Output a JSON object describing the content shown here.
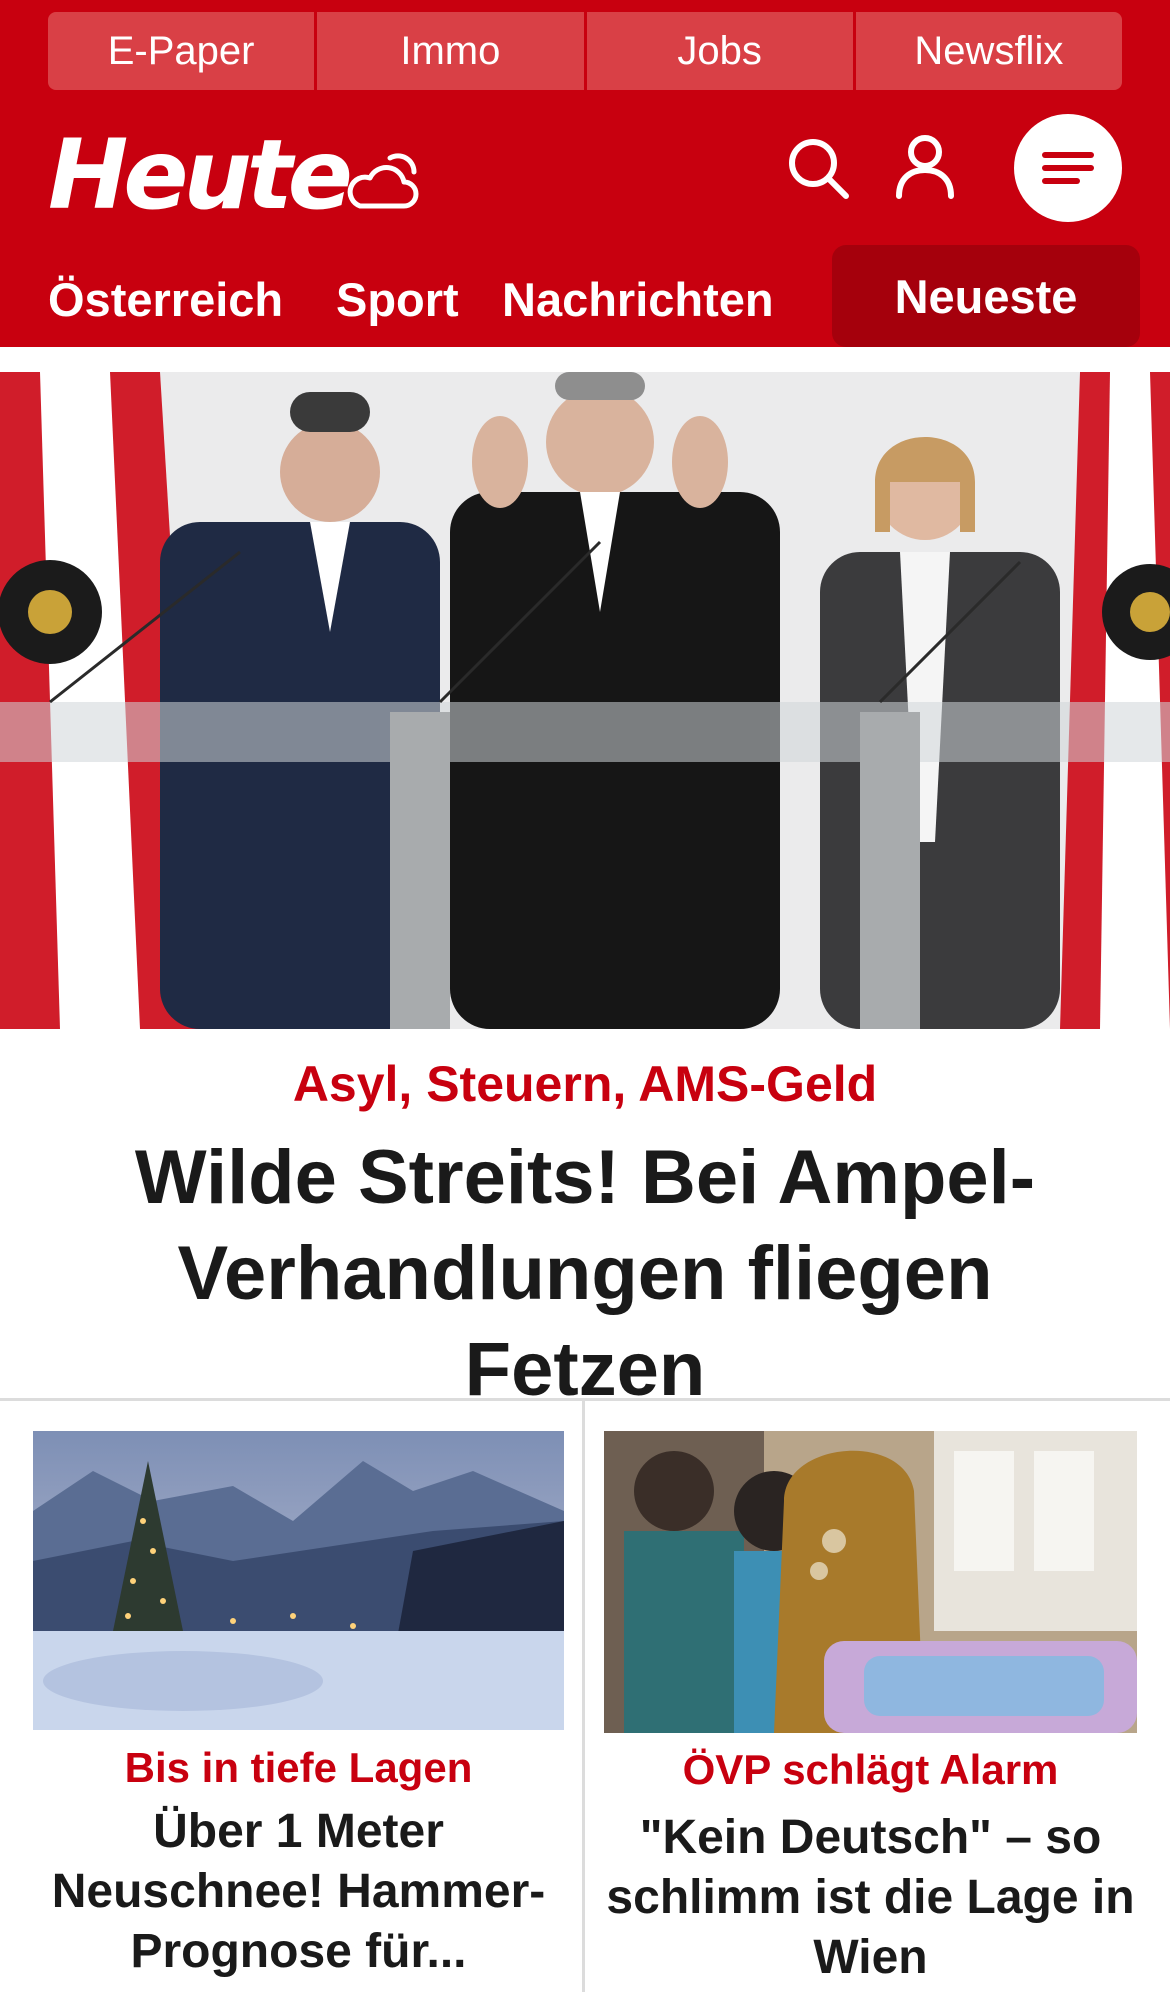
{
  "top_links": [
    "E-Paper",
    "Immo",
    "Jobs",
    "Newsflix"
  ],
  "brand": {
    "logo_text": "Heute"
  },
  "icons": {
    "weather": "cloud-sun-icon",
    "search": "search-icon",
    "account": "user-icon",
    "menu": "menu-icon"
  },
  "nav": {
    "items": [
      "Österreich",
      "Sport",
      "Nachrichten"
    ],
    "active": "Neueste"
  },
  "colors": {
    "brand_red": "#c8000f",
    "top_link_bg": "#d94046",
    "nav_active_bg": "#a5000c",
    "headline": "#1a1a1a",
    "divider": "#dcdcdc"
  },
  "hero": {
    "kicker": "Asyl, Steuern, AMS-Geld",
    "title": "Wilde Streits! Bei Ampel-Verhandlungen fliegen Fetzen"
  },
  "teasers": [
    {
      "kicker": "Bis in tiefe Lagen",
      "title": "Über 1 Meter Neuschnee! Hammer-Prognose für..."
    },
    {
      "kicker": "ÖVP schlägt Alarm",
      "title": "\"Kein Deutsch\" – so schlimm ist die Lage in Wien"
    }
  ]
}
